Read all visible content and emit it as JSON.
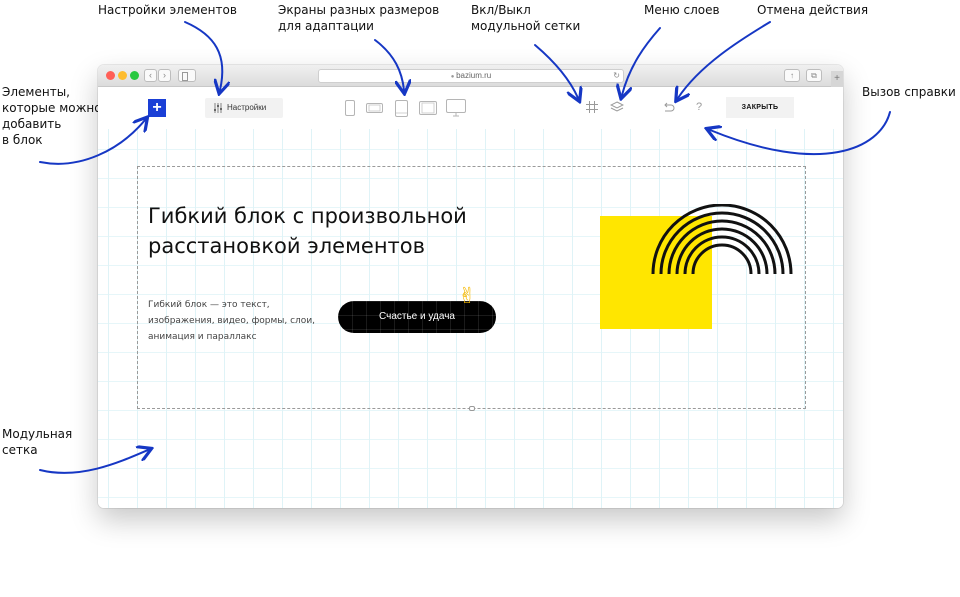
{
  "annotations": {
    "settings": "Настройки элементов",
    "screens": "Экраны разных размеров\nдля адаптации",
    "grid_toggle": "Вкл/Выкл\nмодульной сетки",
    "layers_menu": "Меню слоев",
    "undo": "Отмена действия",
    "add_elements": "Элементы,\nкоторые можно\nдобавить\nв блок",
    "help": "Вызов справки",
    "grid": "Модульная\nсетка"
  },
  "browser": {
    "url": "bazium.ru"
  },
  "toolbar": {
    "add_label": "+",
    "settings_label": "Настройки",
    "devices": [
      "phone-portrait-icon",
      "phone-landscape-icon",
      "tablet-portrait-icon",
      "tablet-landscape-icon",
      "desktop-icon"
    ],
    "help_label": "?",
    "close_label": "ЗАКРЫТЬ"
  },
  "block": {
    "headline": "Гибкий блок с произвольной расстановкой элементов",
    "description": "Гибкий блок — это текст, изображения, видео, формы, слои, анимация и параллакс",
    "button_label": "Счастье и удача",
    "emoji": "✌"
  },
  "colors": {
    "accent_blue": "#1a3fd6",
    "arrow_blue": "#1637c4",
    "yellow": "#ffe600",
    "grid": "#dff3f7"
  }
}
